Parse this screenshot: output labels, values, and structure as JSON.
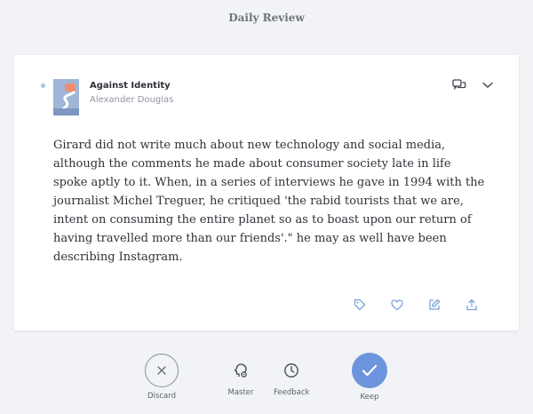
{
  "header": {
    "title": "Daily Review"
  },
  "card": {
    "book_title": "Against Identity",
    "author": "Alexander Douglas",
    "highlight": "Girard did not write much about new technology and social media, although the comments he made about consumer society late in life spoke aptly to it. When, in a series of interviews he gave in 1994 with the journalist Michel Treguer, he critiqued 'the rabid tourists that we are, intent on consuming the entire planet so as to boast upon our return of having travelled more than our friends'.\" he may as well have been describing Instagram.",
    "top_icons": [
      "comments-icon",
      "chevron-down-icon"
    ],
    "bottom_icons": [
      "tag-icon",
      "heart-icon",
      "edit-icon",
      "share-icon"
    ]
  },
  "review_actions": {
    "discard_label": "Discard",
    "master_label": "Master",
    "feedback_label": "Feedback",
    "keep_label": "Keep"
  },
  "colors": {
    "accent": "#6c95de",
    "icon": "#7aa0d8",
    "background": "#f1f3f6"
  }
}
